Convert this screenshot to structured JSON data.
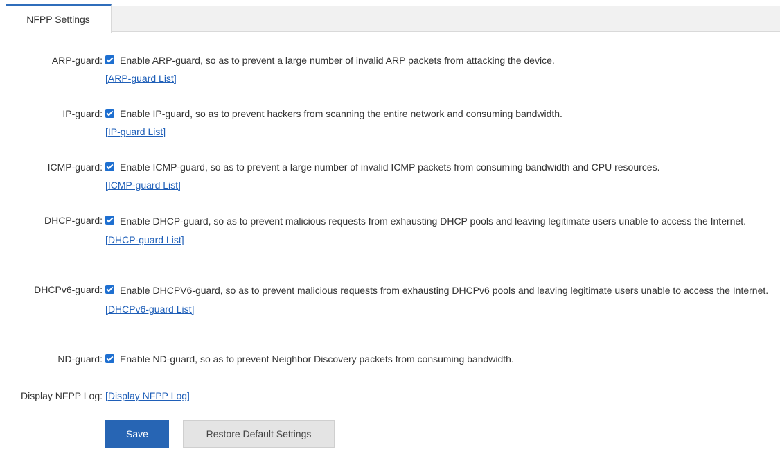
{
  "tabs": [
    {
      "label": "NFPP Settings",
      "active": true
    }
  ],
  "colors": {
    "accent": "#2f6dbb",
    "checkbox": "#1e6fd0",
    "link": "#1f5fb8",
    "primary_button": "#2765b4"
  },
  "settings": {
    "arp": {
      "label": "ARP-guard:",
      "checked": true,
      "text": "Enable ARP-guard, so as to prevent a large number of invalid ARP packets from attacking the device.",
      "link": "[ARP-guard List]"
    },
    "ip": {
      "label": "IP-guard:",
      "checked": true,
      "text": "Enable IP-guard, so as to prevent hackers from scanning the entire network and consuming bandwidth.",
      "link": "[IP-guard List]"
    },
    "icmp": {
      "label": "ICMP-guard:",
      "checked": true,
      "text": "Enable ICMP-guard, so as to prevent a large number of invalid ICMP packets from consuming bandwidth and CPU resources.",
      "link": "[ICMP-guard List]"
    },
    "dhcp": {
      "label": "DHCP-guard:",
      "checked": true,
      "text": "Enable DHCP-guard, so as to prevent malicious requests from exhausting DHCP pools and leaving legitimate users unable to access the Internet.",
      "link": "[DHCP-guard List]"
    },
    "dhcpv6": {
      "label": "DHCPv6-guard:",
      "checked": true,
      "text": "Enable DHCPV6-guard, so as to prevent malicious requests from exhausting DHCPv6 pools and leaving legitimate users unable to access the Internet.",
      "link": "[DHCPv6-guard List]"
    },
    "nd": {
      "label": "ND-guard:",
      "checked": true,
      "text": "Enable ND-guard, so as to prevent Neighbor Discovery packets from consuming bandwidth."
    }
  },
  "log": {
    "label": "Display NFPP Log:",
    "link": "[Display NFPP Log]"
  },
  "buttons": {
    "save": "Save",
    "restore": "Restore Default Settings"
  }
}
